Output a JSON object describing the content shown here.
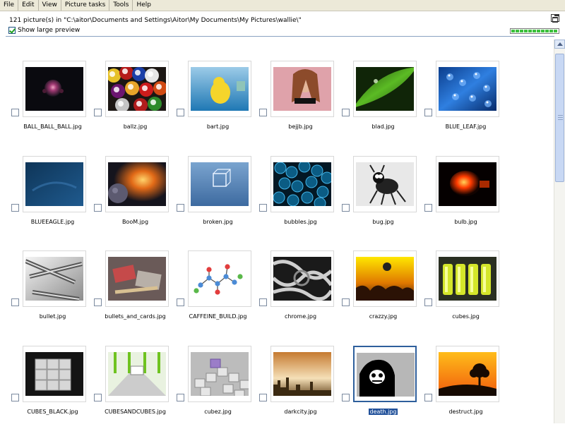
{
  "menu": [
    "File",
    "Edit",
    "View",
    "Picture tasks",
    "Tools",
    "Help"
  ],
  "info": "121 picture(s) in \"C:\\aitor\\Documents and Settings\\Aitor\\My Documents\\My Pictures\\wallie\\\"",
  "show_large_preview": {
    "label": "Show large preview",
    "checked": true
  },
  "thumbnails": [
    {
      "name": "BALL_BALL_BALL.jpg"
    },
    {
      "name": "ballz.jpg"
    },
    {
      "name": "bart.jpg"
    },
    {
      "name": "bejjb.jpg"
    },
    {
      "name": "blad.jpg"
    },
    {
      "name": "BLUE_LEAF.jpg"
    },
    {
      "name": "BLUEEAGLE.jpg"
    },
    {
      "name": "BooM.jpg"
    },
    {
      "name": "broken.jpg"
    },
    {
      "name": "bubbles.jpg"
    },
    {
      "name": "bug.jpg"
    },
    {
      "name": "bulb.jpg"
    },
    {
      "name": "bullet.jpg"
    },
    {
      "name": "bullets_and_cards.jpg"
    },
    {
      "name": "CAFFEINE_BUILD.jpg"
    },
    {
      "name": "chrome.jpg"
    },
    {
      "name": "crazzy.jpg"
    },
    {
      "name": "cubes.jpg"
    },
    {
      "name": "CUBES_BLACK.jpg"
    },
    {
      "name": "CUBESANDCUBES.jpg"
    },
    {
      "name": "cubez.jpg"
    },
    {
      "name": "darkcity.jpg"
    },
    {
      "name": "death.jpg",
      "selected": true
    },
    {
      "name": "destruct.jpg"
    }
  ]
}
